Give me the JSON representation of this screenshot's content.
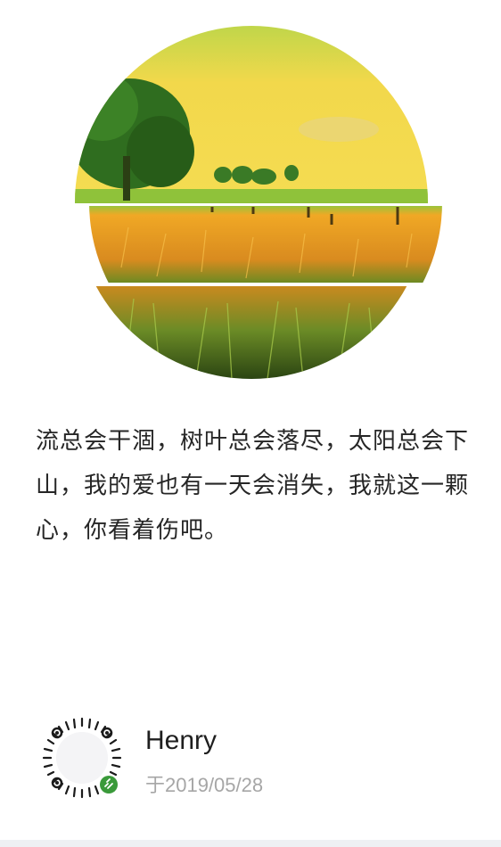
{
  "post": {
    "quote": "流总会干涸，树叶总会落尽，太阳总会下山，我的爱也有一天会消失，我就这一颗心，你看着伤吧。"
  },
  "author": {
    "name": "Henry",
    "date": "于2019/05/28"
  },
  "colors": {
    "text": "#262626",
    "muted": "#a6a6a6",
    "sky": "#f4dc4a",
    "grass": "#e3a32a",
    "tree": "#2c6b1f",
    "badge": "#3a9a3a"
  },
  "icons": {
    "qr": "mini-program-code-icon",
    "badge": "link-badge-icon"
  }
}
